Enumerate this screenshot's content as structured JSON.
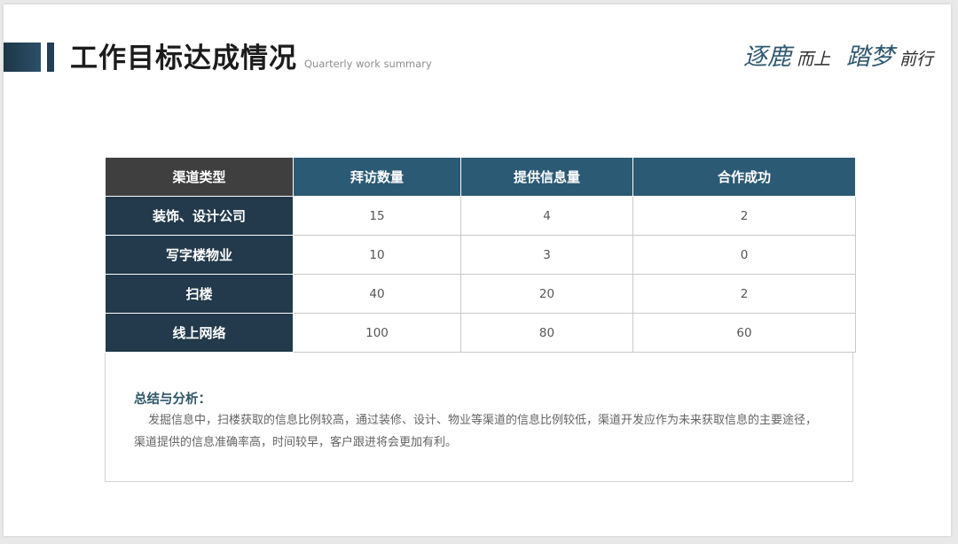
{
  "header": {
    "title": "工作目标达成情况",
    "subtitle": "Quarterly work summary",
    "slogan": {
      "part1_big": "逐鹿",
      "part1_small": "而上",
      "part2_big": "踏梦",
      "part2_small": "前行"
    }
  },
  "table": {
    "columns": [
      "渠道类型",
      "拜访数量",
      "提供信息量",
      "合作成功"
    ],
    "rows": [
      {
        "channel": "装饰、设计公司",
        "visits": "15",
        "info": "4",
        "success": "2"
      },
      {
        "channel": "写字楼物业",
        "visits": "10",
        "info": "3",
        "success": "0"
      },
      {
        "channel": "扫楼",
        "visits": "40",
        "info": "20",
        "success": "2"
      },
      {
        "channel": "线上网络",
        "visits": "100",
        "info": "80",
        "success": "60"
      }
    ]
  },
  "summary": {
    "title": "总结与分析：",
    "body": "发掘信息中，扫楼获取的信息比例较高，通过装修、设计、物业等渠道的信息比例较低，渠道开发应作为未来获取信息的主要途径，渠道提供的信息准确率高，时间较早，客户跟进将会更加有利。"
  },
  "colors": {
    "accent": "#2b5a74",
    "row_header": "#223a4b",
    "corner_header": "#3f3f3f",
    "slogan": "#2f5870"
  }
}
